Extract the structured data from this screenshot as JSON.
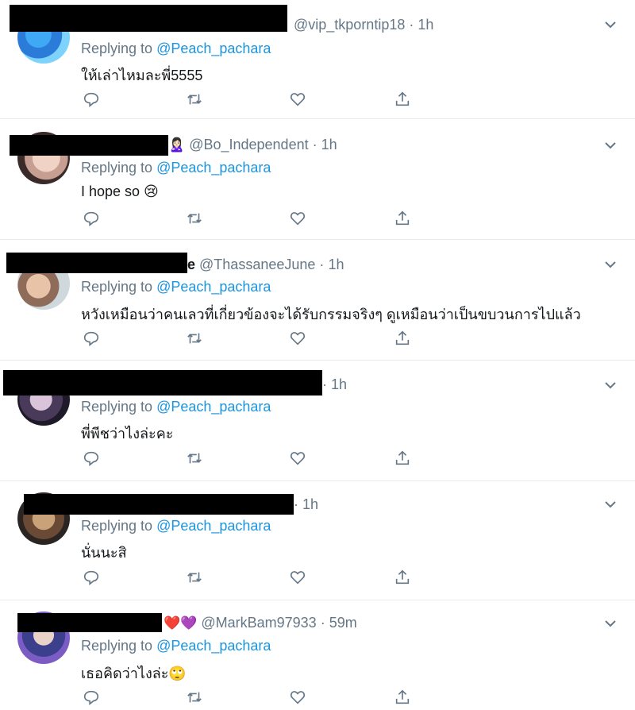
{
  "tweets": [
    {
      "handle": "@vip_tkporntip18",
      "suffix": "",
      "time": "1h",
      "replying_prefix": "Replying to ",
      "replying_to": "@Peach_pachara",
      "text": "ให้เล่าไหมละพี่5555"
    },
    {
      "handle": "@Bo_Independent",
      "suffix": "🙎🏻‍♀️",
      "time": "1h",
      "replying_prefix": "Replying to ",
      "replying_to": "@Peach_pachara",
      "text": "I hope so 😢"
    },
    {
      "handle": "@ThassaneeJune",
      "suffix": "e",
      "time": "1h",
      "replying_prefix": "Replying to ",
      "replying_to": "@Peach_pachara",
      "text": "หวังเหมือนว่าคนเลวที่เกี่ยวข้องจะได้รับกรรมจริงๆ ดูเหมือนว่าเป็นขบวนการไปแล้ว"
    },
    {
      "handle": "",
      "suffix": "",
      "time": "1h",
      "replying_prefix": "Replying to ",
      "replying_to": "@Peach_pachara",
      "text": "พี่พีชว่าไงล่ะคะ"
    },
    {
      "handle": "",
      "suffix": "",
      "time": "1h",
      "replying_prefix": "Replying to ",
      "replying_to": "@Peach_pachara",
      "text": "นั่นนะสิ"
    },
    {
      "handle": "@MarkBam97933",
      "suffix": "❤️💜",
      "time": "59m",
      "replying_prefix": "Replying to ",
      "replying_to": "@Peach_pachara",
      "text": "เธอคิดว่าไงล่ะ🙄"
    }
  ],
  "dot": "·",
  "icons": [
    "reply-icon",
    "retweet-icon",
    "like-icon",
    "share-icon",
    "chevron-down-icon"
  ],
  "colors": {
    "muted": "#657786",
    "link": "#1b95e0",
    "divider": "#e6ecf0"
  }
}
